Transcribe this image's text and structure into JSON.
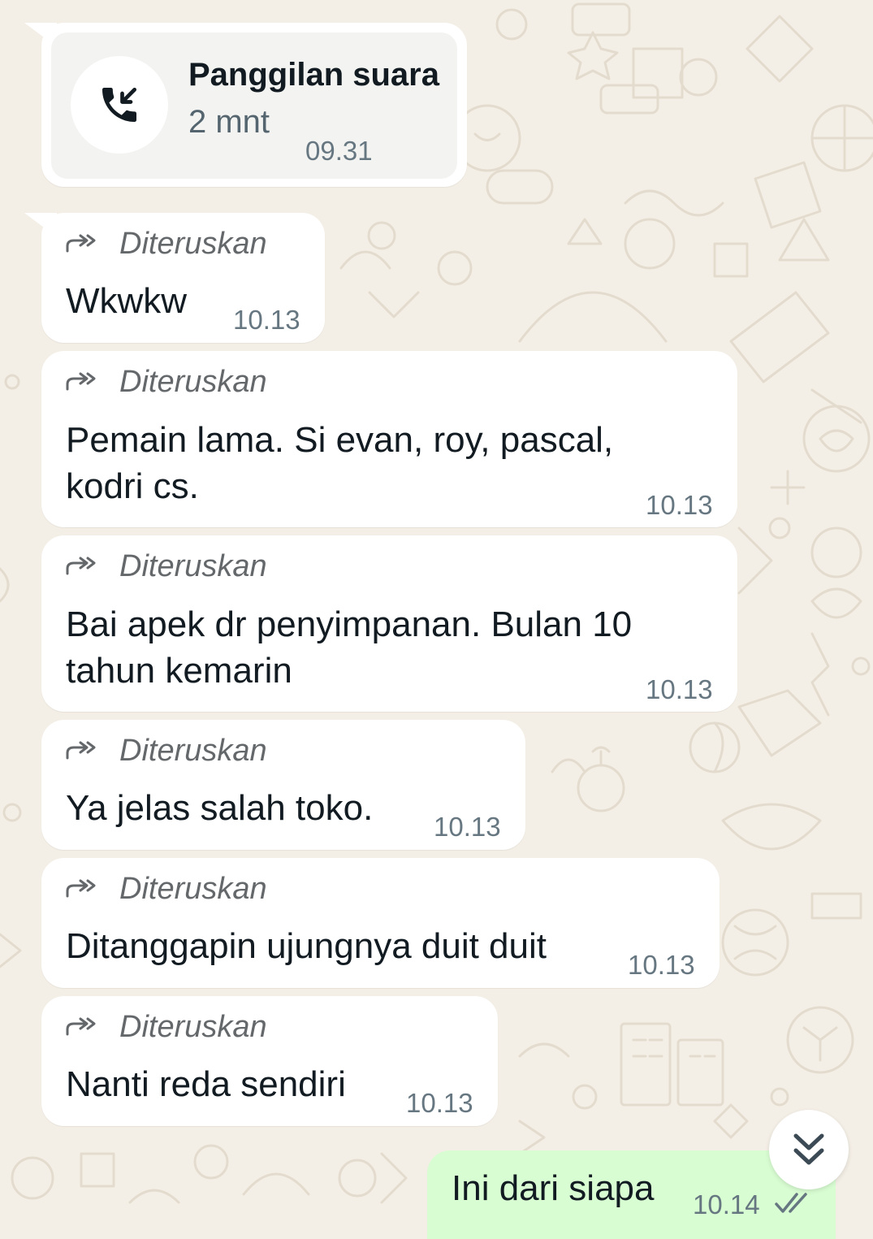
{
  "call": {
    "title": "Panggilan suara",
    "duration": "2 mnt",
    "time": "09.31",
    "icon": "incoming-call-icon"
  },
  "forwarded_label": "Diteruskan",
  "messages": [
    {
      "text_lines": [
        "Wkwkw"
      ],
      "time": "10.13"
    },
    {
      "text_lines": [
        "Pemain lama. Si evan, roy, pascal,",
        "kodri cs."
      ],
      "time": "10.13"
    },
    {
      "text_lines": [
        "Bai apek dr penyimpanan. Bulan 10",
        "tahun kemarin"
      ],
      "time": "10.13"
    },
    {
      "text_lines": [
        "Ya jelas salah toko."
      ],
      "time": "10.13"
    },
    {
      "text_lines": [
        "Ditanggapin ujungnya duit duit"
      ],
      "time": "10.13"
    },
    {
      "text_lines": [
        "Nanti reda sendiri"
      ],
      "time": "10.13"
    }
  ],
  "outgoing": {
    "text": "Ini dari siapa",
    "time": "10.14",
    "status": "double-check-icon"
  },
  "scroll_button": {
    "icon": "double-chevron-down-icon"
  },
  "colors": {
    "background": "#F4EFE6",
    "incoming_bubble": "#FFFFFF",
    "outgoing_bubble": "#D9FDD3",
    "text": "#111B21",
    "meta": "#667781",
    "forwarded": "#65686B"
  }
}
